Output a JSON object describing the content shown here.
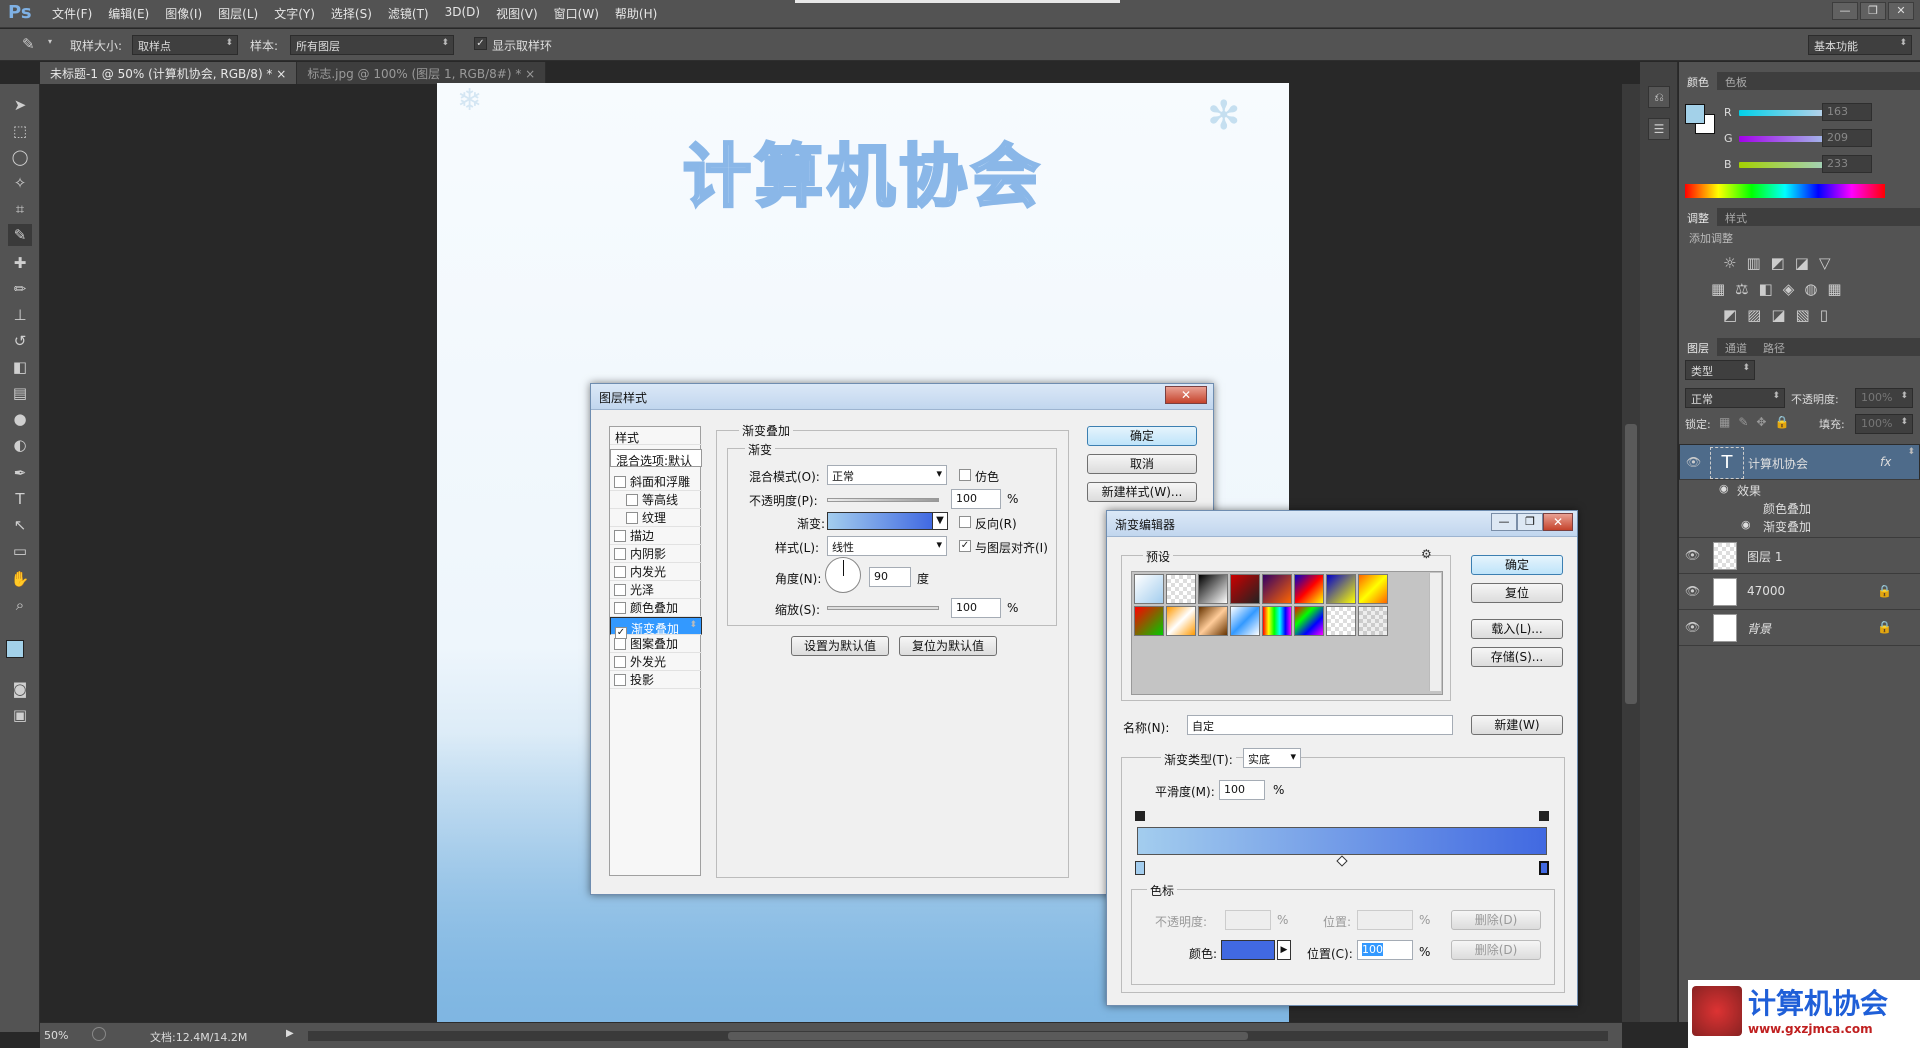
{
  "app": {
    "logo": "Ps",
    "menu": [
      "文件(F)",
      "编辑(E)",
      "图像(I)",
      "图层(L)",
      "文字(Y)",
      "选择(S)",
      "滤镜(T)",
      "3D(D)",
      "视图(V)",
      "窗口(W)",
      "帮助(H)"
    ],
    "window_controls": [
      "—",
      "❐",
      "✕"
    ]
  },
  "options_bar": {
    "sample_size_label": "取样大小:",
    "sample_size_value": "取样点",
    "sample_label": "样本:",
    "sample_value": "所有图层",
    "show_ring_label": "显示取样环",
    "workspace": "基本功能"
  },
  "tabs": [
    {
      "label": "未标题-1 @ 50% (计算机协会, RGB/8) *",
      "close": "×"
    },
    {
      "label": "标志.jpg @ 100% (图层 1, RGB/8#) *",
      "close": "×"
    }
  ],
  "document": {
    "title_art": "计算机协会"
  },
  "status": {
    "zoom": "50%",
    "doc_info": "文档:12.4M/14.2M"
  },
  "color_panel": {
    "tabs": [
      "颜色",
      "色板"
    ],
    "r_label": "R",
    "g_label": "G",
    "b_label": "B",
    "r": "163",
    "g": "209",
    "b": "233",
    "fg_color": "#a3d1e9",
    "bg_color": "#ffffff"
  },
  "adjust_panel": {
    "tabs": [
      "调整",
      "样式"
    ],
    "add_label": "添加调整"
  },
  "layers_panel": {
    "tabs": [
      "图层",
      "通道",
      "路径"
    ],
    "filter_kind": "类型",
    "blend_mode": "正常",
    "opacity_label": "不透明度:",
    "opacity_value": "100%",
    "lock_label": "锁定:",
    "fill_label": "填充:",
    "fill_value": "100%",
    "layers": [
      {
        "name": "计算机协会",
        "fx": "fx",
        "type_icon": "T"
      },
      {
        "name": "图层 1"
      },
      {
        "name": "47000"
      },
      {
        "name": "背景"
      }
    ],
    "effects_label": "效果",
    "effect_items": [
      "颜色叠加",
      "渐变叠加"
    ]
  },
  "layer_style_dialog": {
    "title": "图层样式",
    "close": "✕",
    "styles_header": "样式",
    "blend_options": "混合选项:默认",
    "items": [
      {
        "label": "斜面和浮雕",
        "checked": false,
        "indent": false
      },
      {
        "label": "等高线",
        "checked": false,
        "indent": true
      },
      {
        "label": "纹理",
        "checked": false,
        "indent": true
      },
      {
        "label": "描边",
        "checked": false,
        "indent": false
      },
      {
        "label": "内阴影",
        "checked": false,
        "indent": false
      },
      {
        "label": "内发光",
        "checked": false,
        "indent": false
      },
      {
        "label": "光泽",
        "checked": false,
        "indent": false
      },
      {
        "label": "颜色叠加",
        "checked": false,
        "indent": false
      },
      {
        "label": "渐变叠加",
        "checked": true,
        "indent": false
      },
      {
        "label": "图案叠加",
        "checked": false,
        "indent": false
      },
      {
        "label": "外发光",
        "checked": false,
        "indent": false
      },
      {
        "label": "投影",
        "checked": false,
        "indent": false
      }
    ],
    "section_title": "渐变叠加",
    "sub_title": "渐变",
    "blend_mode_label": "混合模式(O):",
    "blend_mode_value": "正常",
    "dither_label": "仿色",
    "opacity_label": "不透明度(P):",
    "opacity_value": "100",
    "pct": "%",
    "gradient_label": "渐变:",
    "reverse_label": "反向(R)",
    "style_label": "样式(L):",
    "style_value": "线性",
    "align_label": "与图层对齐(I)",
    "angle_label": "角度(N):",
    "angle_value": "90",
    "angle_unit": "度",
    "scale_label": "缩放(S):",
    "scale_value": "100",
    "set_default": "设置为默认值",
    "reset_default": "复位为默认值",
    "ok": "确定",
    "cancel": "取消",
    "new_style": "新建样式(W)..."
  },
  "gradient_editor": {
    "title": "渐变编辑器",
    "win_controls": [
      "—",
      "❐",
      "✕"
    ],
    "presets_label": "预设",
    "ok": "确定",
    "reset": "复位",
    "load": "载入(L)...",
    "save": "存储(S)...",
    "name_label": "名称(N):",
    "name_value": "自定",
    "new": "新建(W)",
    "type_label": "渐变类型(T):",
    "type_value": "实底",
    "smooth_label": "平滑度(M):",
    "smooth_value": "100",
    "pct": "%",
    "stops_title": "色标",
    "opacity_label": "不透明度:",
    "position_label": "位置:",
    "delete": "删除(D)",
    "color_label": "颜色:",
    "position_c_label": "位置(C):",
    "position_c_value": "100",
    "stop_color": "#4169e1",
    "gradient_start": "#a3cdee",
    "gradient_end": "#4169e1"
  },
  "watermark": {
    "text": "计算机协会",
    "url": "www.gxzjmca.com"
  }
}
